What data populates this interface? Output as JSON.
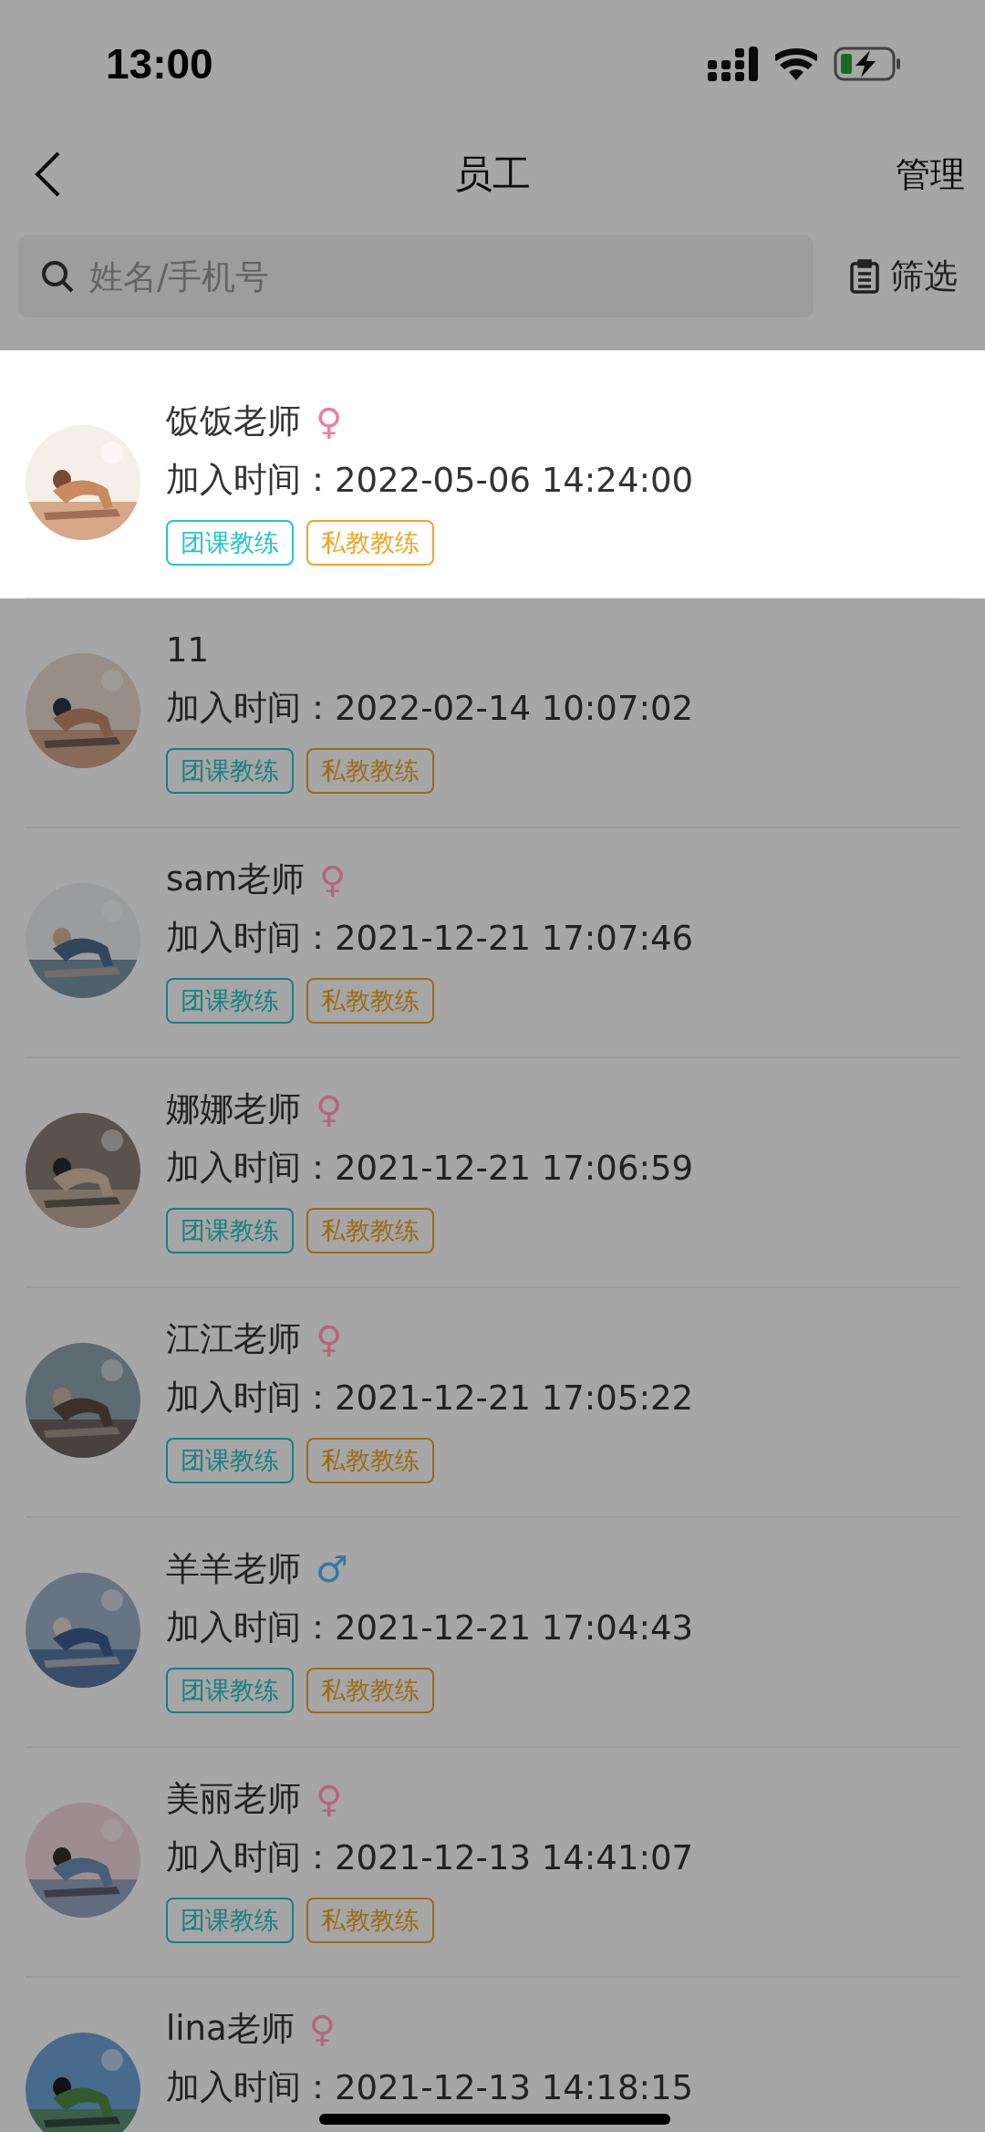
{
  "status_bar": {
    "time": "13:00"
  },
  "nav": {
    "title": "员工",
    "action": "管理"
  },
  "search": {
    "placeholder": "姓名/手机号",
    "filter": "筛选"
  },
  "staff": [
    {
      "name": "饭饭老师",
      "gender": "♀",
      "color": "#ee7f9e",
      "joined_label": "加入时间：",
      "joined": "2022-05-06 14:24:00",
      "tags": [
        "团课教练",
        "私教教练"
      ],
      "highlighted": true
    },
    {
      "name": "11",
      "joined_label": "加入时间：",
      "joined": "2022-02-14 10:07:02",
      "tags": [
        "团课教练",
        "私教教练"
      ],
      "highlighted": false
    },
    {
      "name": "sam老师",
      "gender": "♀",
      "color": "#b56679",
      "joined_label": "加入时间：",
      "joined": "2021-12-21 17:07:46",
      "tags": [
        "团课教练",
        "私教教练"
      ],
      "highlighted": false
    },
    {
      "name": "娜娜老师",
      "gender": "♀",
      "color": "#b56679",
      "joined_label": "加入时间：",
      "joined": "2021-12-21 17:06:59",
      "tags": [
        "团课教练",
        "私教教练"
      ],
      "highlighted": false
    },
    {
      "name": "江江老师",
      "gender": "♀",
      "color": "#b56679",
      "joined_label": "加入时间：",
      "joined": "2021-12-21 17:05:22",
      "tags": [
        "团课教练",
        "私教教练"
      ],
      "highlighted": false
    },
    {
      "name": "羊羊老师",
      "gender": "♂",
      "color": "#2f7aa3",
      "joined_label": "加入时间：",
      "joined": "2021-12-21 17:04:43",
      "tags": [
        "团课教练",
        "私教教练"
      ],
      "highlighted": false
    },
    {
      "name": "美丽老师",
      "gender": "♀",
      "color": "#b56679",
      "joined_label": "加入时间：",
      "joined": "2021-12-13 14:41:07",
      "tags": [
        "团课教练",
        "私教教练"
      ],
      "highlighted": false
    },
    {
      "name": "lina老师",
      "gender": "♀",
      "color": "#b56679",
      "joined_label": "加入时间：",
      "joined": "2021-12-13 14:18:15",
      "highlighted": false
    }
  ]
}
